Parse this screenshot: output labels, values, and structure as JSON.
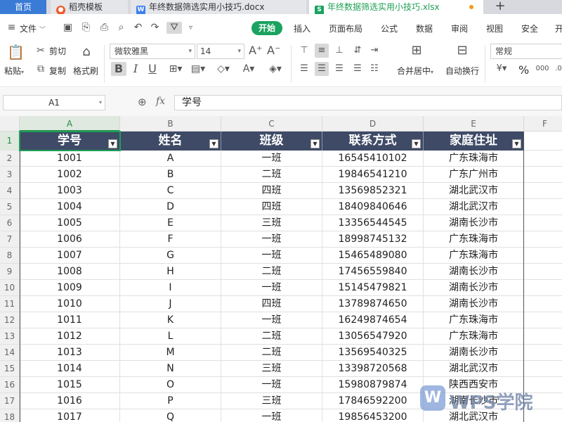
{
  "tabs": {
    "home": "首页",
    "docer": "稻壳模板",
    "doc": "年终数据筛选实用小技巧.docx",
    "xls": "年终数据筛选实用小技巧.xlsx",
    "add": "+"
  },
  "menu": {
    "file": "文件",
    "start": "开始",
    "insert": "插入",
    "layout": "页面布局",
    "formula": "公式",
    "data": "数据",
    "review": "审阅",
    "view": "视图",
    "security": "安全",
    "more": "开"
  },
  "ribbon": {
    "paste": "粘贴",
    "cut": "剪切",
    "copy": "复制",
    "format_painter": "格式刷",
    "font_name": "微软雅黑",
    "font_size": "14",
    "merge": "合并居中",
    "wrap": "自动换行",
    "number_format": "常规",
    "percent": "%"
  },
  "formula_bar": {
    "name_box": "A1",
    "fx": "fx",
    "content": "学号"
  },
  "columns": [
    "A",
    "B",
    "C",
    "D",
    "E",
    "F"
  ],
  "headers": [
    "学号",
    "姓名",
    "班级",
    "联系方式",
    "家庭住址"
  ],
  "rows": [
    [
      "1001",
      "A",
      "一班",
      "16545410102",
      "广东珠海市"
    ],
    [
      "1002",
      "B",
      "二班",
      "19846541210",
      "广东广州市"
    ],
    [
      "1003",
      "C",
      "四班",
      "13569852321",
      "湖北武汉市"
    ],
    [
      "1004",
      "D",
      "四班",
      "18409840646",
      "湖北武汉市"
    ],
    [
      "1005",
      "E",
      "三班",
      "13356544545",
      "湖南长沙市"
    ],
    [
      "1006",
      "F",
      "一班",
      "18998745132",
      "广东珠海市"
    ],
    [
      "1007",
      "G",
      "一班",
      "15465489080",
      "广东珠海市"
    ],
    [
      "1008",
      "H",
      "二班",
      "17456559840",
      "湖南长沙市"
    ],
    [
      "1009",
      "I",
      "一班",
      "15145479821",
      "湖南长沙市"
    ],
    [
      "1010",
      "J",
      "四班",
      "13789874650",
      "湖南长沙市"
    ],
    [
      "1011",
      "K",
      "一班",
      "16249874654",
      "广东珠海市"
    ],
    [
      "1012",
      "L",
      "二班",
      "13056547920",
      "广东珠海市"
    ],
    [
      "1013",
      "M",
      "二班",
      "13569540325",
      "湖南长沙市"
    ],
    [
      "1014",
      "N",
      "三班",
      "13398720568",
      "湖北武汉市"
    ],
    [
      "1015",
      "O",
      "一班",
      "15980879874",
      "陕西西安市"
    ],
    [
      "1016",
      "P",
      "三班",
      "17846592200",
      "湖南长沙市"
    ],
    [
      "1017",
      "Q",
      "一班",
      "19856453200",
      "湖北武汉市"
    ]
  ],
  "row_numbers": [
    "1",
    "2",
    "3",
    "4",
    "5",
    "6",
    "7",
    "8",
    "9",
    "10",
    "11",
    "12",
    "13",
    "14",
    "15",
    "16",
    "17",
    "18"
  ],
  "watermark": "WPS学院",
  "colors": {
    "header_fill": "#3e4a66",
    "accent_green": "#1aa260",
    "tab_home": "#3a7bd5"
  }
}
